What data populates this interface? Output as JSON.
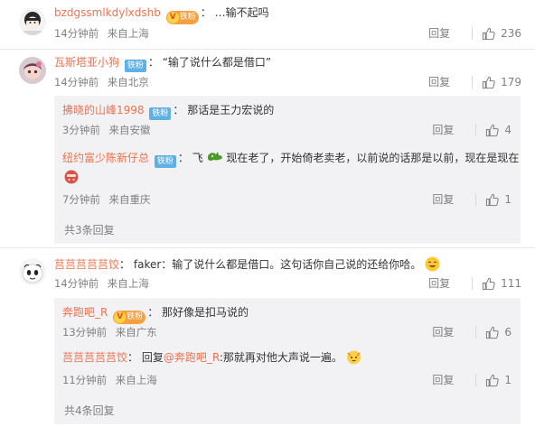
{
  "comments": [
    {
      "user": "bzdgssmlkdylxdshb",
      "badge": "铁粉",
      "text": "…输不起吗",
      "time": "14分钟前",
      "location": "来自上海",
      "reply_label": "回复",
      "likes": "236"
    },
    {
      "user": "瓦斯塔亚小狗",
      "badge": "铁粉",
      "text": "“输了说什么都是借口”",
      "time": "14分钟前",
      "location": "来自北京",
      "reply_label": "回复",
      "likes": "179",
      "replies": [
        {
          "user": "拂晓的山峰1998",
          "badge": "铁粉",
          "text": "那话是王力宏说的",
          "time": "3分钟前",
          "location": "来自安徽",
          "reply_label": "回复",
          "likes": "4"
        },
        {
          "user": "纽约富少陈新仔总",
          "badge": "铁粉",
          "text_a": "飞",
          "text_b": "现在老了，开始倚老卖老，以前说的话那是以前，现在是现在",
          "time": "7分钟前",
          "location": "来自重庆",
          "reply_label": "回复",
          "likes": "1"
        }
      ],
      "more_replies": "共3条回复"
    },
    {
      "user": "莒莒莒莒莒饺",
      "text": "faker：输了说什么都是借口。这句话你自己说的还给你哈。",
      "time": "14分钟前",
      "location": "来自上海",
      "reply_label": "回复",
      "likes": "111",
      "replies": [
        {
          "user": "奔跑吧_R",
          "badge": "铁粉",
          "text": "那好像是扣马说的",
          "time": "13分钟前",
          "location": "来自广东",
          "reply_label": "回复",
          "likes": "6"
        },
        {
          "user": "莒莒莒莒莒饺",
          "text_prefix": "回复",
          "mention": "@奔跑吧_R",
          "text": ":那就再对他大声说一遍。",
          "time": "11分钟前",
          "location": "来自上海",
          "reply_label": "回复",
          "likes": "1"
        }
      ],
      "more_replies": "共4条回复"
    }
  ],
  "colors": {
    "username": "#eb7350",
    "meta": "#808080",
    "reply_bg": "#f2f2f5",
    "fan_badge": "#5fb1e5",
    "vip_badge": "#f59f3e"
  },
  "icons": [
    "thumbs-up-icon",
    "vip-crown-icon",
    "emoji-icon",
    "avatar"
  ]
}
